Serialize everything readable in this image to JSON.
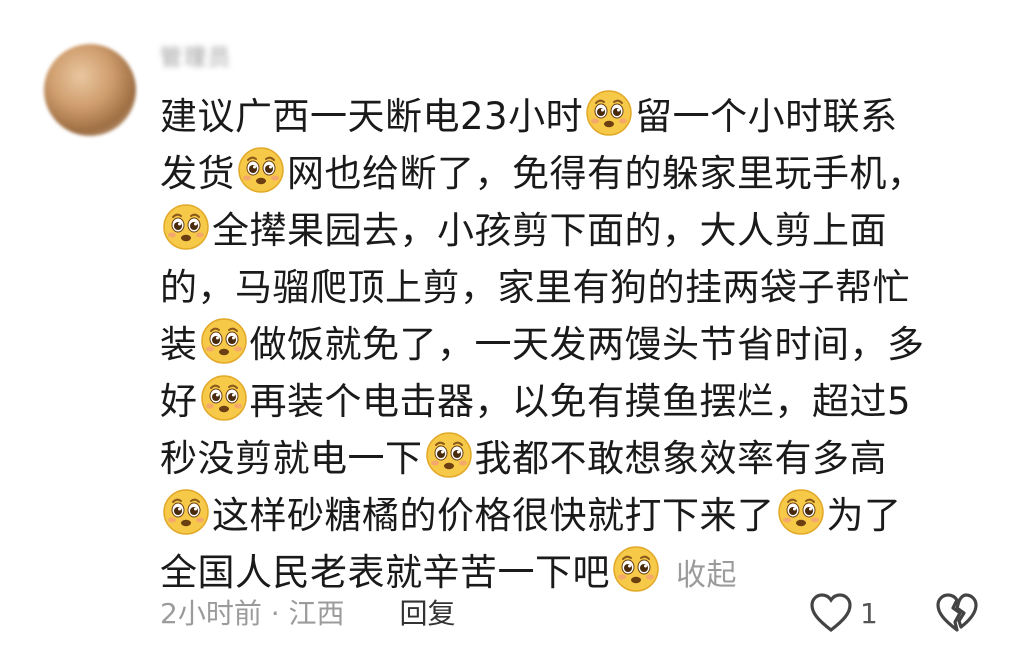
{
  "comment": {
    "username": "管理员",
    "lines": [
      [
        "建议广西一天断电23小时",
        "emoji",
        "留一个小时联系"
      ],
      [
        "发货",
        "emoji",
        "网也给断了，免得有的躲家里玩手机，"
      ],
      [
        "emoji",
        "全撵果园去，小孩剪下面的，大人剪上面"
      ],
      [
        "的，马骝爬顶上剪，家里有狗的挂两袋子帮忙"
      ],
      [
        "装",
        "emoji",
        "做饭就免了，一天发两馒头节省时间，多"
      ],
      [
        "好",
        "emoji",
        "再装个电击器，以免有摸鱼摆烂，超过5"
      ],
      [
        "秒没剪就电一下",
        "emoji",
        "我都不敢想象效率有多高"
      ],
      [
        "emoji",
        "这样砂糖橘的价格很快就打下来了",
        "emoji",
        "为了"
      ],
      [
        "全国人民老表就辛苦一下吧",
        "emoji"
      ]
    ],
    "collapse_label": "收起",
    "time": "2小时前",
    "separator": "·",
    "location": "江西",
    "reply_label": "回复",
    "like_count": "1",
    "emoji_name": "pleading-face-icon"
  },
  "colors": {
    "text": "#1a1a1a",
    "meta": "#9b9b9b",
    "emoji_face": "#f7c948"
  }
}
